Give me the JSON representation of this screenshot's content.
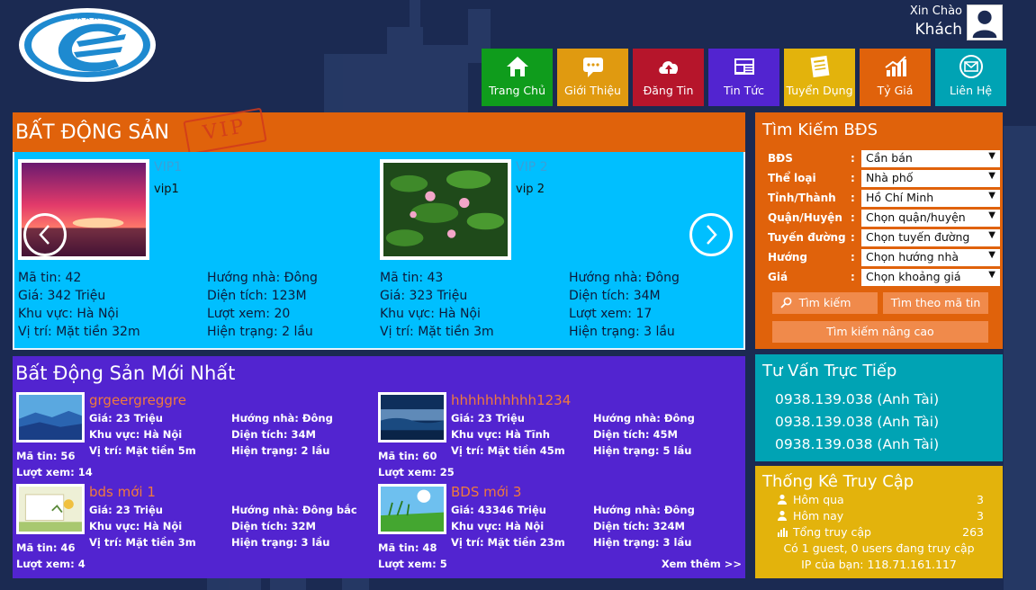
{
  "header": {
    "greeting": "Xin Chào",
    "user_name": "Khách"
  },
  "nav": [
    {
      "label": "Trang Chủ",
      "color": "#0f9c1c",
      "icon": "home-icon"
    },
    {
      "label": "Giới Thiệu",
      "color": "#e09a10",
      "icon": "chat-icon"
    },
    {
      "label": "Đăng Tin",
      "color": "#b6152b",
      "icon": "cloud-upload-icon"
    },
    {
      "label": "Tin Tức",
      "color": "#5224d0",
      "icon": "newspaper-icon"
    },
    {
      "label": "Tuyển Dụng",
      "color": "#e3b30c",
      "icon": "resume-icon"
    },
    {
      "label": "Tỷ Giá",
      "color": "#e0620b",
      "icon": "chart-icon"
    },
    {
      "label": "Liên Hệ",
      "color": "#00a3b4",
      "icon": "mail-icon"
    }
  ],
  "vip": {
    "title": "BẤT ĐỘNG SẢN",
    "stamp": "VIP",
    "cards": [
      {
        "name": "VIP1",
        "desc": "vip1",
        "ma_tin": "Mã tin: 42",
        "gia": "Giá: 342 Triệu",
        "khu_vuc": "Khu vực: Hà Nội",
        "vi_tri": "Vị trí: Mặt tiền 32m",
        "huong": "Hướng nhà: Đông",
        "dien_tich": "Diện tích: 123M",
        "luot_xem": "Lượt xem: 20",
        "hien_trang": "Hiện trạng: 2 lầu"
      },
      {
        "name": "VIP 2",
        "desc": "vip 2",
        "ma_tin": "Mã tin: 43",
        "gia": "Giá: 323 Triệu",
        "khu_vuc": "Khu vực: Hà Nội",
        "vi_tri": "Vị trí: Mặt tiền 3m",
        "huong": "Hướng nhà: Đông",
        "dien_tich": "Diện tích: 34M",
        "luot_xem": "Lượt xem: 17",
        "hien_trang": "Hiện trạng: 3 lầu"
      }
    ]
  },
  "new_listings": {
    "title": "Bất Động Sản Mới Nhất",
    "more": "Xem thêm >>",
    "items": [
      {
        "name": "grgeergreggre",
        "gia": "Giá: 23 Triệu",
        "khu_vuc": "Khu vực: Hà Nội",
        "vi_tri": "Vị trí: Mặt tiền 5m",
        "huong": "Hướng nhà: Đông",
        "dien_tich": "Diện tích: 34M",
        "hien_trang": "Hiện trạng: 2 lầu",
        "ma_tin": "Mã tin: 56",
        "luot_xem": "Lượt xem: 14"
      },
      {
        "name": "hhhhhhhhhh1234",
        "gia": "Giá: 23 Triệu",
        "khu_vuc": "Khu vực: Hà Tĩnh",
        "vi_tri": "Vị trí: Mặt tiền 45m",
        "huong": "Hướng nhà: Đông",
        "dien_tich": "Diện tích: 45M",
        "hien_trang": "Hiện trạng: 5 lầu",
        "ma_tin": "Mã tin: 60",
        "luot_xem": "Lượt xem: 25"
      },
      {
        "name": "bds mới 1",
        "gia": "Giá: 23 Triệu",
        "khu_vuc": "Khu vực: Hà Nội",
        "vi_tri": "Vị trí: Mặt tiền 3m",
        "huong": "Hướng nhà: Đông bắc",
        "dien_tich": "Diện tích: 32M",
        "hien_trang": "Hiện trạng: 3 lầu",
        "ma_tin": "Mã tin: 46",
        "luot_xem": "Lượt xem: 4"
      },
      {
        "name": "BDS mới 3",
        "gia": "Giá: 43346 Triệu",
        "khu_vuc": "Khu vực: Hà Nội",
        "vi_tri": "Vị trí: Mặt tiền 23m",
        "huong": "Hướng nhà: Đông",
        "dien_tich": "Diện tích: 324M",
        "hien_trang": "Hiện trạng: 3 lầu",
        "ma_tin": "Mã tin: 48",
        "luot_xem": "Lượt xem: 5"
      }
    ]
  },
  "search": {
    "title": "Tìm Kiếm BĐS",
    "fields": [
      {
        "label": "BĐS",
        "value": "Cần bán"
      },
      {
        "label": "Thể loại",
        "value": "Nhà phố"
      },
      {
        "label": "Tỉnh/Thành",
        "value": "Hồ Chí Minh"
      },
      {
        "label": "Quận/Huyện",
        "value": "Chọn quận/huyện"
      },
      {
        "label": "Tuyến đường",
        "value": "Chọn tuyến đường"
      },
      {
        "label": "Hướng",
        "value": "Chọn hướng nhà"
      },
      {
        "label": "Giá",
        "value": "Chọn khoảng giá"
      }
    ],
    "btn_search": "Tìm kiếm",
    "btn_by_id": "Tìm theo mã tin",
    "btn_advanced": "Tìm kiếm nâng cao"
  },
  "consult": {
    "title": "Tư Vấn Trực Tiếp",
    "phones": [
      "0938.139.038 (Anh Tài)",
      "0938.139.038 (Anh Tài)",
      "0938.139.038 (Anh Tài)"
    ]
  },
  "stats": {
    "title": "Thống Kê Truy Cập",
    "rows": [
      {
        "label": "Hôm qua",
        "value": "3"
      },
      {
        "label": "Hôm nay",
        "value": "3"
      },
      {
        "label": "Tổng truy cập",
        "value": "263"
      }
    ],
    "online": "Có 1 guest, 0 users đang truy cập",
    "ip": "IP của bạn: 118.71.161.117"
  }
}
